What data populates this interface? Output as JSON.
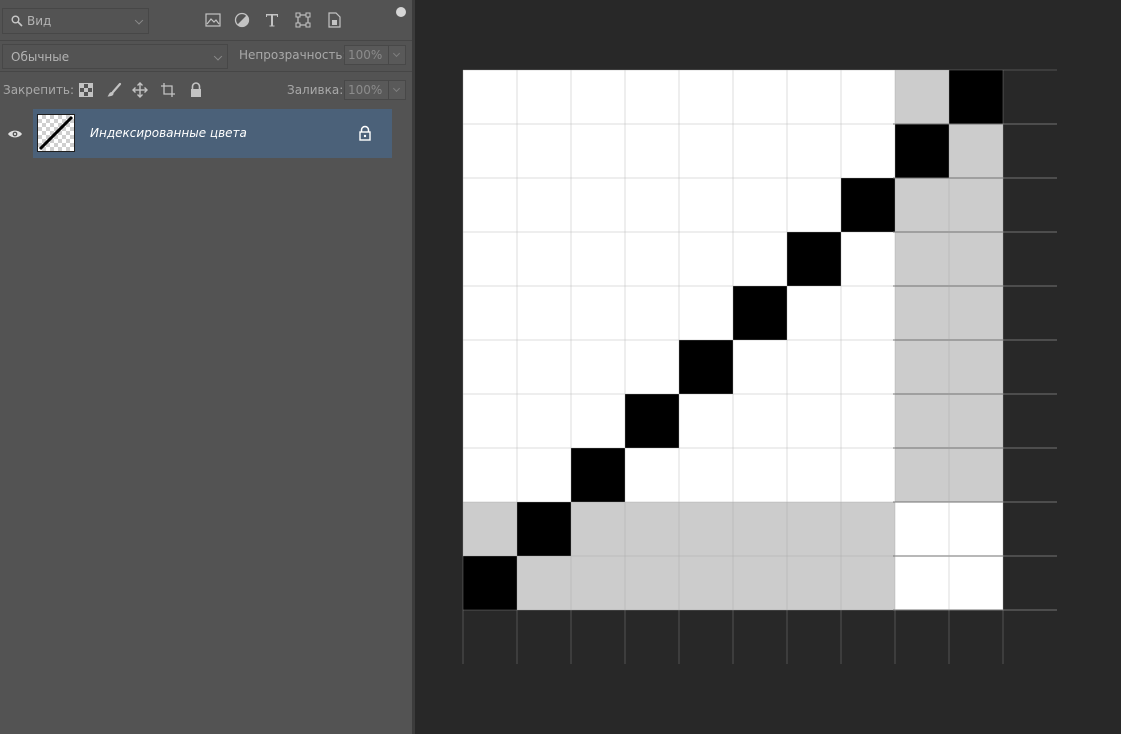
{
  "layers_panel": {
    "filter": {
      "search_label": "Вид",
      "icons": [
        "image-filter-icon",
        "adjustment-filter-icon",
        "type-filter-icon",
        "shape-filter-icon",
        "smart-object-filter-icon"
      ]
    },
    "blend_mode": "Обычные",
    "opacity_label": "Непрозрачность:",
    "opacity_value": "100%",
    "lock_label": "Закрепить:",
    "fill_label": "Заливка:",
    "fill_value": "100%",
    "layers": [
      {
        "name": "Индексированные цвета",
        "visible": true,
        "locked": true,
        "selected": true
      }
    ]
  },
  "canvas": {
    "grid_cols": 10,
    "grid_rows": 10,
    "colors": {
      "W": "#ffffff",
      "B": "#000000",
      "G": "#cccccc"
    },
    "pixels": [
      "WWWWWWWWGB",
      "WWWWWWWWBG",
      "WWWWWWWBGG",
      "WWWWWWBWGG",
      "WWWWWBWWGG",
      "WWWWBWWWGG",
      "WWWBWWWWGG",
      "WWBWWWWWGG",
      "GBGGGGGGWW",
      "BGGGGGGGWW"
    ]
  }
}
